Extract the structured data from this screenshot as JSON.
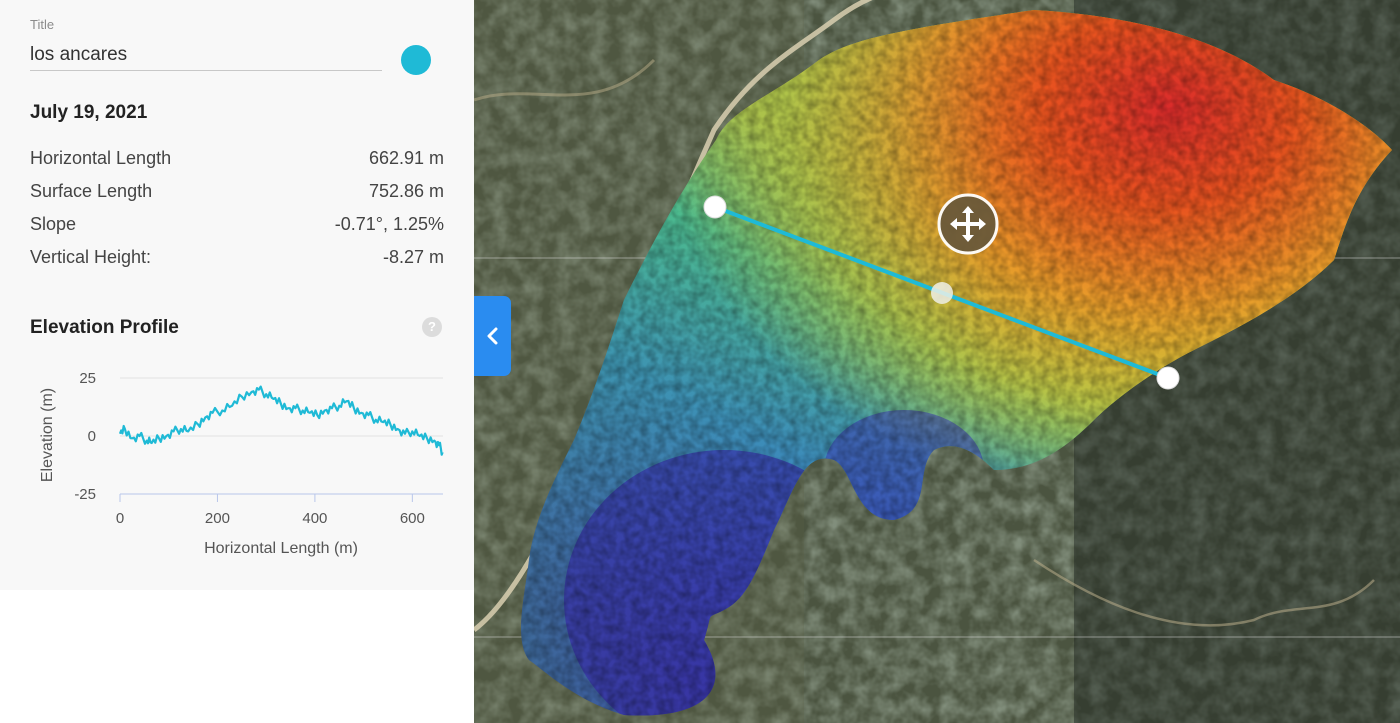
{
  "panel": {
    "title_label": "Title",
    "title_value": "los ancares",
    "accent_color": "#1fbad6",
    "date": "July 19, 2021",
    "metrics": [
      {
        "label": "Horizontal Length",
        "value": "662.91 m"
      },
      {
        "label": "Surface Length",
        "value": "752.86 m"
      },
      {
        "label": "Slope",
        "value": "-0.71°, 1.25%"
      },
      {
        "label": "Vertical Height:",
        "value": "-8.27 m"
      }
    ],
    "profile_title": "Elevation Profile",
    "help_icon": "question-circle-icon",
    "help_glyph": "?"
  },
  "chart_data": {
    "type": "line",
    "xlabel": "Horizontal Length (m)",
    "ylabel": "Elevation (m)",
    "xlim": [
      0,
      662.91
    ],
    "ylim": [
      -25,
      25
    ],
    "xticks": [
      0,
      200,
      400,
      600
    ],
    "yticks": [
      25,
      0,
      -25
    ],
    "grid": true,
    "color": "#1fbad6",
    "x": [
      0,
      10,
      25,
      40,
      55,
      65,
      80,
      95,
      110,
      125,
      140,
      160,
      175,
      190,
      210,
      230,
      250,
      270,
      285,
      300,
      315,
      330,
      345,
      360,
      375,
      390,
      405,
      420,
      435,
      450,
      465,
      480,
      495,
      510,
      525,
      540,
      555,
      570,
      585,
      600,
      615,
      630,
      645,
      655,
      662
    ],
    "y": [
      1,
      3,
      -1,
      0,
      -2,
      -3,
      -1,
      0,
      2,
      3,
      2,
      5,
      8,
      10,
      11,
      13,
      17,
      19,
      20,
      18,
      16,
      14,
      12,
      12,
      11,
      10,
      9,
      11,
      12,
      13,
      15,
      12,
      10,
      9,
      7,
      6,
      5,
      3,
      1,
      2,
      0,
      -1,
      -2,
      -4,
      -7
    ]
  },
  "map": {
    "center_handle_icon": "move-arrows-icon",
    "collapse_icon": "chevron-left-icon",
    "collapse_color": "#2a8cf0",
    "line_color": "#1fbad6"
  }
}
